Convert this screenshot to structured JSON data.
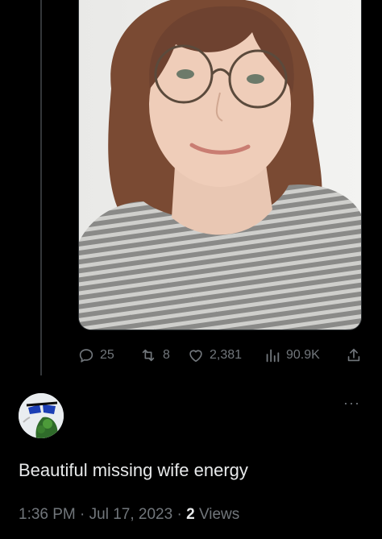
{
  "tweet": {
    "actions": {
      "replies": "25",
      "retweets": "8",
      "likes": "2,381",
      "views": "90.9K"
    },
    "more_label": "···"
  },
  "reply": {
    "text": "Beautiful missing wife energy",
    "time": "1:36 PM",
    "separator": "·",
    "date": "Jul 17, 2023",
    "views_count": "2",
    "views_label": "Views"
  },
  "icons": {
    "reply": "reply-icon",
    "retweet": "retweet-icon",
    "like": "heart-icon",
    "views": "views-icon",
    "share": "share-icon",
    "more": "more-icon"
  },
  "colors": {
    "background": "#000000",
    "text_primary": "#e7e9ea",
    "text_secondary": "#71767b",
    "divider": "#333639"
  }
}
